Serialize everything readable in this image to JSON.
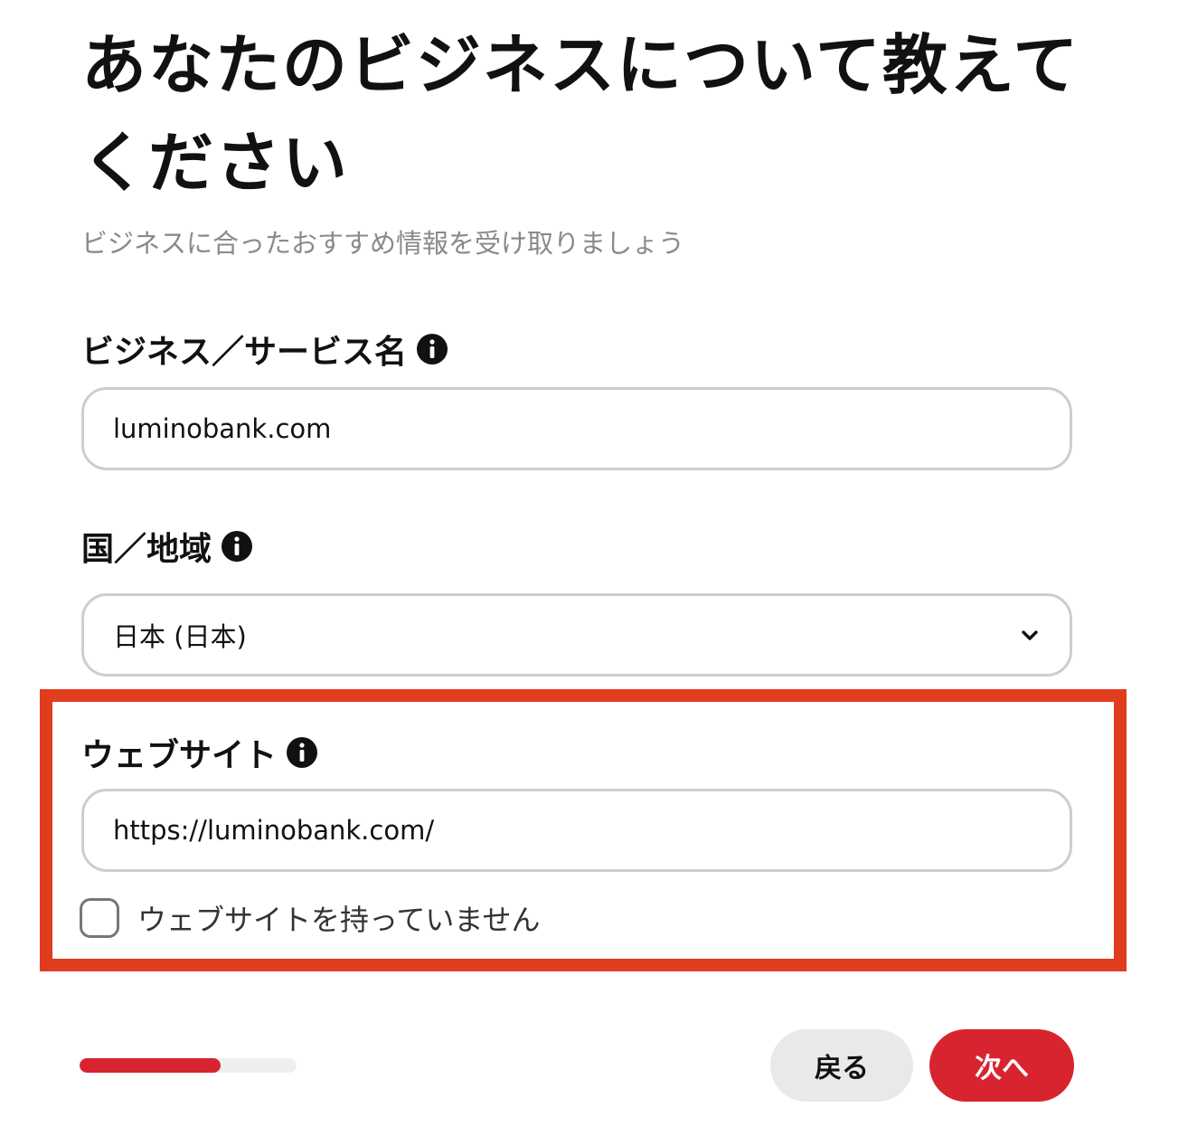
{
  "header": {
    "title": "あなたのビジネスについて教えてください",
    "subtitle": "ビジネスに合ったおすすめ情報を受け取りましょう"
  },
  "form": {
    "business_name": {
      "label": "ビジネス／サービス名",
      "value": "luminobank.com",
      "icon": "info-icon"
    },
    "country": {
      "label": "国／地域",
      "selected": "日本 (日本)",
      "icon": "info-icon"
    },
    "website": {
      "label": "ウェブサイト",
      "value": "https://luminobank.com/",
      "icon": "info-icon",
      "no_website_checkbox": {
        "label": "ウェブサイトを持っていません",
        "checked": false
      }
    }
  },
  "footer": {
    "progress_fraction": 0.65,
    "back_label": "戻る",
    "next_label": "次へ"
  },
  "colors": {
    "accent": "#d8242f",
    "highlight": "#e03c1e",
    "border": "#cdcdcd",
    "subtle_text": "#8a8a8a"
  }
}
